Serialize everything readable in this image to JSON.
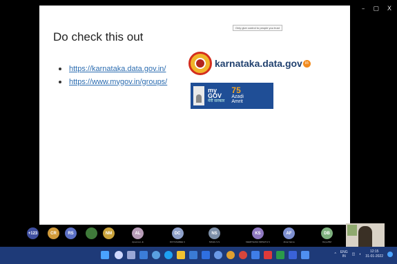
{
  "window": {
    "minimize": "–",
    "maximize": "▢",
    "close": "X"
  },
  "slide": {
    "tooltip": "Only give control to people you trust",
    "title": "Do check this out",
    "links": [
      "https://karnataka.data.gov.in/",
      "https://www.mygov.in/groups/"
    ],
    "karnataka_logo": {
      "text": "karnataka.data.gov",
      "suffix": "in"
    },
    "mygov_banner": {
      "mygov_line1": "my",
      "mygov_line2": "GOV",
      "hindi": "मेरी सरकार",
      "azadi_num": "75",
      "azadi_text": "Azadi",
      "azadi_sub": "Amrit"
    }
  },
  "participants": [
    {
      "initials": "+123",
      "name": "",
      "color": "#3f4fa0"
    },
    {
      "initials": "CR",
      "name": "",
      "color": "#d19a3a"
    },
    {
      "initials": "RS",
      "name": "",
      "color": "#5b6fc4"
    },
    {
      "initials": "",
      "name": "",
      "color": "#3f7a3a"
    },
    {
      "initials": "NM",
      "name": "",
      "color": "#c9a23b"
    },
    {
      "initials": "AL",
      "name": "Apoorva L.E",
      "color": "#b79cb7"
    },
    {
      "initials": "DC",
      "name": "DIVYASHREE C",
      "color": "#8ea0c9"
    },
    {
      "initials": "NS",
      "name": "NIKHIL S.S",
      "color": "#7d8fa8"
    },
    {
      "initials": "KS",
      "name": "KEERTHANA SRINATH S",
      "color": "#8f78c0"
    },
    {
      "initials": "AF",
      "name": "Alina Fatma",
      "color": "#7d8fcf"
    },
    {
      "initials": "DB",
      "name": "Divya BM",
      "color": "#7eb07e"
    }
  ],
  "tray": {
    "lang1": "ENG",
    "lang2": "IN",
    "time": "12:15",
    "date": "31-01-2022"
  }
}
